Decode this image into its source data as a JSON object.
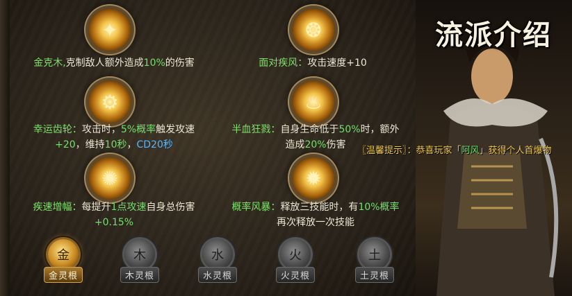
{
  "title": "流派介绍",
  "skills": [
    {
      "icon": "sword-glow-icon",
      "parts": [
        "金克木,",
        "克制敌人额外造成",
        "10%",
        "的伤害"
      ]
    },
    {
      "icon": "wind-fire-icon",
      "parts": [
        "面对疾风：",
        "攻击速度+10"
      ]
    },
    {
      "icon": "gear-ring-icon",
      "line1": [
        "幸运齿轮：",
        "攻击时，",
        "5%概率",
        "触发攻速"
      ],
      "line2": [
        "+20",
        "，维持",
        "10秒",
        "，",
        "CD20秒"
      ]
    },
    {
      "icon": "rage-figure-icon",
      "line1": [
        "半血狂戮：",
        "自身生命低于",
        "50%",
        "时，额外"
      ],
      "line2": [
        "造成",
        "20%",
        "伤害"
      ]
    },
    {
      "icon": "speed-burst-icon",
      "line1": [
        "疾速增幅：",
        "每提升",
        "1点攻速",
        "自身总伤害"
      ],
      "line2": [
        "+0.15%"
      ]
    },
    {
      "icon": "storm-swirl-icon",
      "line1": [
        "概率风暴：",
        "释放三技能时，有",
        "10%概率"
      ],
      "line2": [
        "再次释放一次技能"
      ]
    }
  ],
  "elements": [
    {
      "glyph": "金",
      "label": "金灵根",
      "active": true
    },
    {
      "glyph": "木",
      "label": "木灵根",
      "active": false
    },
    {
      "glyph": "水",
      "label": "水灵根",
      "active": false
    },
    {
      "glyph": "火",
      "label": "火灵根",
      "active": false
    },
    {
      "glyph": "土",
      "label": "土灵根",
      "active": false
    }
  ],
  "announcement": {
    "prefix": "〖温馨提示〗：恭喜玩家「",
    "player": "阿风",
    "suffix": "」获得个人首爆物"
  }
}
